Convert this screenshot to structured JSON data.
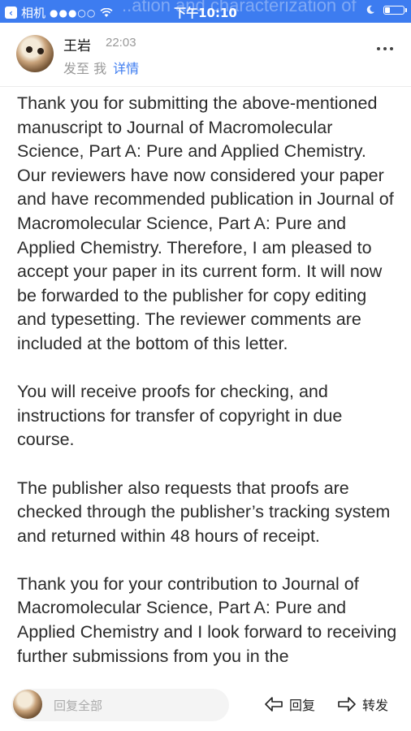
{
  "status_bar": {
    "back_app": "相机",
    "signal_dots": "●●●○○",
    "time": "下午10:10",
    "background_text": "..ation and characterization of",
    "battery_level": 0.25
  },
  "header": {
    "sender": "王岩",
    "time": "22:03",
    "to_text": "发至 我",
    "detail_link": "详情"
  },
  "body": {
    "paragraphs": [
      "Thank you for submitting the above-mentioned manuscript to Journal of Macromolecular Science, Part A: Pure and Applied Chemistry. Our reviewers have now considered your paper and have recommended publication in Journal of Macromolecular Science, Part A: Pure and Applied Chemistry. Therefore, I am pleased to accept your paper in its current form. It will now be forwarded to the publisher for copy editing and typesetting. The reviewer comments are included at the bottom of this letter.",
      "You will receive proofs for checking, and instructions for transfer of copyright in due course.",
      "The publisher also requests that proofs are checked through the publisher’s tracking system and returned within 48 hours of receipt.",
      "Thank you for your contribution to Journal of Macromolecular Science, Part A: Pure and Applied Chemistry and I look forward to receiving further submissions from you in the"
    ]
  },
  "bottom_bar": {
    "reply_all": "回复全部",
    "reply": "回复",
    "forward": "转发"
  },
  "colors": {
    "accent": "#3d7cf0"
  }
}
